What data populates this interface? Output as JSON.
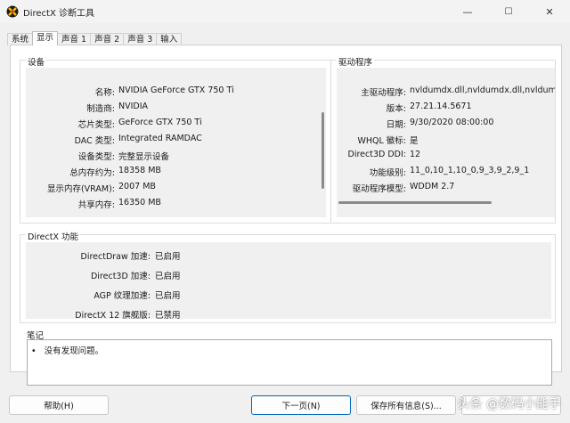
{
  "window": {
    "title": "DirectX 诊断工具",
    "minimize_glyph": "—",
    "maximize_glyph": "☐",
    "close_glyph": "✕"
  },
  "tabs": [
    {
      "label": "系统",
      "active": false
    },
    {
      "label": "显示",
      "active": true
    },
    {
      "label": "声音 1",
      "active": false
    },
    {
      "label": "声音 2",
      "active": false
    },
    {
      "label": "声音 3",
      "active": false
    },
    {
      "label": "输入",
      "active": false
    }
  ],
  "device": {
    "title": "设备",
    "rows": [
      {
        "label": "名称:",
        "value": "NVIDIA GeForce GTX 750 Ti"
      },
      {
        "label": "制造商:",
        "value": "NVIDIA"
      },
      {
        "label": "芯片类型:",
        "value": "GeForce GTX 750 Ti"
      },
      {
        "label": "DAC 类型:",
        "value": "Integrated RAMDAC"
      },
      {
        "label": "设备类型:",
        "value": "完整显示设备"
      },
      {
        "label": "总内存约为:",
        "value": "18358 MB"
      },
      {
        "label": "显示内存(VRAM):",
        "value": "2007 MB"
      },
      {
        "label": "共享内存:",
        "value": "16350 MB"
      }
    ]
  },
  "driver": {
    "title": "驱动程序",
    "rows": [
      {
        "label": "主驱动程序:",
        "value": "nvldumdx.dll,nvldumdx.dll,nvldumdx.c"
      },
      {
        "label": "版本:",
        "value": "27.21.14.5671"
      },
      {
        "label": "日期:",
        "value": "9/30/2020 08:00:00"
      },
      {
        "label": "WHQL 徽标:",
        "value": "是"
      },
      {
        "label": "Direct3D DDI:",
        "value": "12"
      },
      {
        "label": "功能级别:",
        "value": "11_0,10_1,10_0,9_3,9_2,9_1"
      },
      {
        "label": "驱动程序模型:",
        "value": "WDDM 2.7"
      }
    ]
  },
  "features": {
    "title": "DirectX 功能",
    "rows": [
      {
        "label": "DirectDraw 加速:",
        "value": "已启用"
      },
      {
        "label": "Direct3D 加速:",
        "value": "已启用"
      },
      {
        "label": "AGP 纹理加速:",
        "value": "已启用"
      },
      {
        "label": "DirectX 12 旗舰版:",
        "value": "已禁用"
      }
    ]
  },
  "notes": {
    "title": "笔记",
    "items": [
      "没有发现问题。"
    ]
  },
  "buttons": {
    "help": "帮助(H)",
    "next": "下一页(N)",
    "save": "保存所有信息(S)..."
  },
  "watermark": "头条 @数码小能手"
}
